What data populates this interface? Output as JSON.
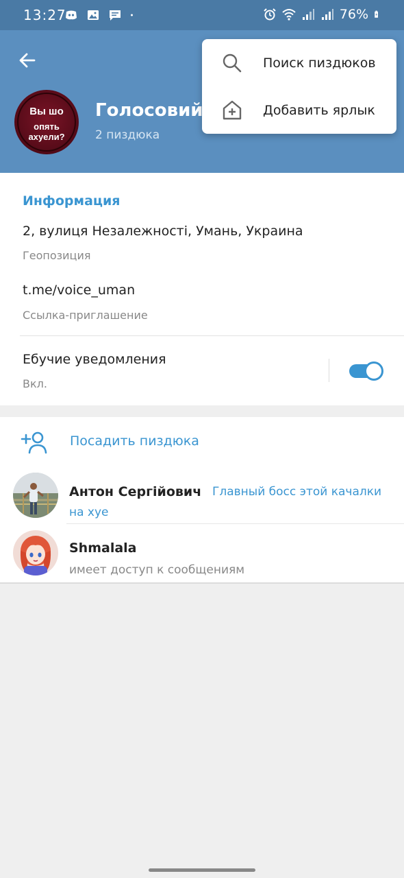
{
  "status_bar": {
    "time": "13:27",
    "battery": "76%",
    "notification_icons": [
      "discord-icon",
      "gallery-icon",
      "message-icon",
      "dot-icon"
    ],
    "system_icons": [
      "alarm-icon",
      "wifi-icon",
      "signal-icon",
      "signal-icon",
      "battery-icon"
    ]
  },
  "header": {
    "avatar_text_line1": "Вы шо",
    "avatar_text_line2": "опять ахуели?",
    "title": "Голосовий Ч",
    "subtitle": "2 пиздюка"
  },
  "menu": {
    "items": [
      {
        "label": "Поиск пиздюков",
        "icon": "search-icon"
      },
      {
        "label": "Добавить ярлык",
        "icon": "add-shortcut-icon"
      }
    ]
  },
  "info": {
    "section_title": "Информация",
    "location": "2, вулиця Незалежності, Умань, Украина",
    "location_label": "Геопозиция",
    "invite_link": "t.me/voice_uman",
    "invite_label": "Ссылка-приглашение",
    "notifications": "Ебучие уведомления",
    "notifications_state": "Вкл.",
    "notifications_enabled": true
  },
  "members": {
    "add_label": "Посадить пиздюка",
    "list": [
      {
        "name": "Антон Сергійович",
        "role_line1": "Главный босс этой качалки",
        "role_line2": "на хуе"
      },
      {
        "name": "Shmalala",
        "status": "имеет доступ к сообщениям"
      }
    ]
  },
  "colors": {
    "header": "#5b8fbf",
    "status_bar": "#4a7aa5",
    "accent": "#3a95d1"
  }
}
